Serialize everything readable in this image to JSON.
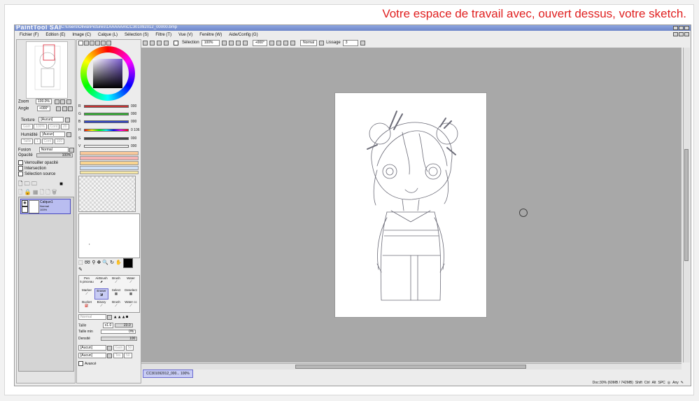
{
  "caption": "Votre espace de travail avec, ouvert dessus, votre sketch.",
  "app": {
    "logo": "PaintTool SAI",
    "title_path": "C:\\Users\\Olivia\\Pictures\\1AAAAAA\\CC301092012_00000.bmp"
  },
  "menu": [
    "Fichier (F)",
    "Edition (E)",
    "Image (C)",
    "Calque (L)",
    "Sélection (S)",
    "Filtre (T)",
    "Vue (V)",
    "Fenêtre (W)",
    "Aide/Config (G)"
  ],
  "navigator": {
    "zoom_label": "Zoom",
    "zoom_value": "100.0%",
    "angle_label": "Angle",
    "angle_value": "+000°",
    "texture_label": "Texture",
    "texture_value": "[Aucun]",
    "texture_sub1": "Gain",
    "texture_sub1_value": "100%",
    "texture_sub2": "Cont",
    "texture_sub2_value": "20",
    "humidity_label": "Humidité",
    "humidity_value": "[Aucun]",
    "humidity_sub1": "Taille",
    "humidity_sub1_value": "1",
    "humidity_sub2": "Cont",
    "humidity_sub2_value": "100",
    "fusion_label": "Fusion",
    "fusion_value": "Normal",
    "opacity_label": "Opacité",
    "opacity_value": "100%",
    "lock_opacity": "Verrouiller opacité",
    "intersection": "Intersection",
    "selection_source": "Sélection source"
  },
  "layer": {
    "name": "Calque1",
    "mode": "Normal",
    "opacity": "100%"
  },
  "color": {
    "labels": [
      "R",
      "G",
      "B",
      "H",
      "S",
      "V"
    ],
    "values": [
      "000",
      "000",
      "000",
      "0 106",
      "000",
      "000"
    ],
    "slider_colors": [
      "#c83232",
      "#32b432",
      "#3246c8",
      "#ff7a00",
      "#444444",
      "#f4f4f4"
    ],
    "swatches": [
      "#f7c79a",
      "#f6b4b4",
      "#f9d48f",
      "#cfe0f5",
      "#f7e8a6"
    ]
  },
  "brushes": [
    {
      "name": "Pen",
      "sub": "5 pinceau"
    },
    {
      "name": "AirBrush",
      "sub": ""
    },
    {
      "name": "Brush",
      "sub": ""
    },
    {
      "name": "Water",
      "sub": ""
    },
    {
      "name": "Marker",
      "sub": ""
    },
    {
      "name": "Eraser",
      "sub": ""
    },
    {
      "name": "Select",
      "sub": ""
    },
    {
      "name": "Deselect",
      "sub": ""
    },
    {
      "name": "Bucket",
      "sub": ""
    },
    {
      "name": "Binary",
      "sub": ""
    },
    {
      "name": "Brush",
      "sub": ""
    },
    {
      "name": "Water cc",
      "sub": ""
    }
  ],
  "brush_props": {
    "mode_value": "Normal",
    "size_label": "Taille",
    "size_mult": "x1.0",
    "size_value": "23.0",
    "min_size_label": "Taille min",
    "min_size_value": "0%",
    "density_label": "Densité",
    "density_value": "100",
    "tex1_value": "[Aucun]",
    "tex1_sub": "Gain",
    "tex1_sub_value": "50",
    "tex2_value": "[Aucun]",
    "tex2_sub": "Tex",
    "tex2_sub_value": "50",
    "advanced_label": "Avancé"
  },
  "toolbar": {
    "selection_label": "Sélection",
    "zoom_value": "100%",
    "angle_value": "+000°",
    "mode_value": "Normal",
    "smoothing_label": "Lissage",
    "smoothing_value": "3"
  },
  "doc_tab": {
    "name": "CC301092012_000...",
    "zoom": "100%"
  },
  "status": {
    "memory": "Doc:30% (60MB / 742MB)",
    "keys": [
      "Shift",
      "Ctrl",
      "Alt",
      "SPC"
    ],
    "tail": "Any"
  }
}
